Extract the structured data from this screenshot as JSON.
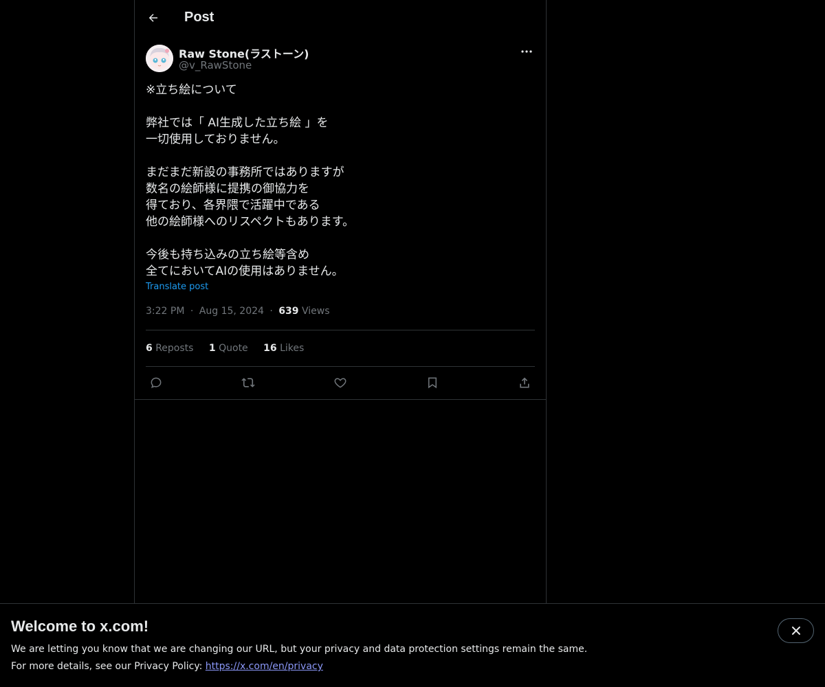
{
  "header": {
    "title": "Post",
    "back_icon": "arrow-left-icon"
  },
  "post": {
    "author": {
      "name": "Raw Stone(ラストーン)",
      "handle": "@v_RawStone"
    },
    "text_lines": [
      "※立ち絵について",
      "",
      "弊社では「 AI生成した立ち絵 」を",
      "一切使用しておりません。",
      "",
      "まだまだ新設の事務所ではありますが",
      "数名の絵師様に提携の御協力を",
      "得ており、各界隈で活躍中である",
      "他の絵師様へのリスペクトもあります。",
      "",
      "今後も持ち込みの立ち絵等含め",
      "全てにおいてAIの使用はありません。"
    ],
    "translate_label": "Translate post",
    "time": "3:22 PM",
    "date": "Aug 15, 2024",
    "separator": "·",
    "views_count": "639",
    "views_label": "Views",
    "stats": {
      "reposts_count": "6",
      "reposts_label": "Reposts",
      "quote_count": "1",
      "quote_label": "Quote",
      "likes_count": "16",
      "likes_label": "Likes"
    }
  },
  "banner": {
    "title": "Welcome to x.com!",
    "line1": "We are letting you know that we are changing our URL, but your privacy and data protection settings remain the same.",
    "line2_prefix": "For more details, see our Privacy Policy: ",
    "link_text": "https://x.com/en/privacy"
  },
  "colors": {
    "background": "#000000",
    "text": "#e7e9ea",
    "muted": "#71767b",
    "accent": "#1d9bf0",
    "border": "#2f3336"
  }
}
